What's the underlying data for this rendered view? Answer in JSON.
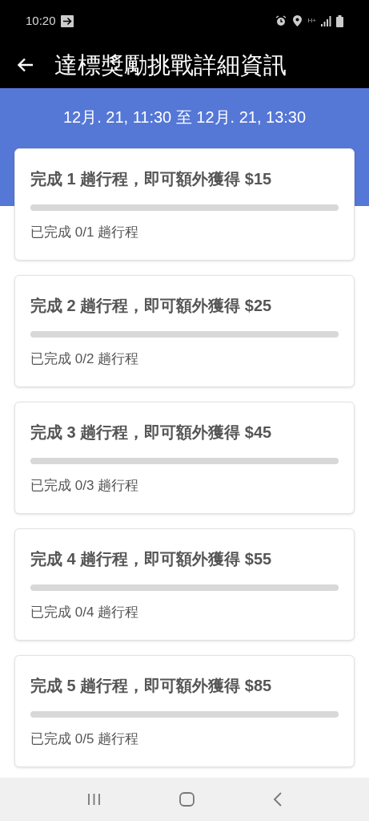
{
  "status_bar": {
    "time": "10:20",
    "network": "H+"
  },
  "header": {
    "title": "達標獎勵挑戰詳細資訊"
  },
  "period": "12月. 21, 11:30 至 12月. 21, 13:30",
  "challenges": [
    {
      "title": "完成 1 趟行程，即可額外獲得 $15",
      "level": 0,
      "progress": "已完成 0/1 趟行程"
    },
    {
      "title": "完成 2 趟行程，即可額外獲得 $25",
      "level": 0,
      "progress": "已完成 0/2 趟行程"
    },
    {
      "title": "完成 3 趟行程，即可額外獲得 $45",
      "level": 0,
      "progress": "已完成 0/3 趟行程"
    },
    {
      "title": "完成 4 趟行程，即可額外獲得 $55",
      "level": 0,
      "progress": "已完成 0/4 趟行程"
    },
    {
      "title": "完成 5 趟行程，即可額外獲得 $85",
      "level": 0,
      "progress": "已完成 0/5 趟行程"
    }
  ]
}
